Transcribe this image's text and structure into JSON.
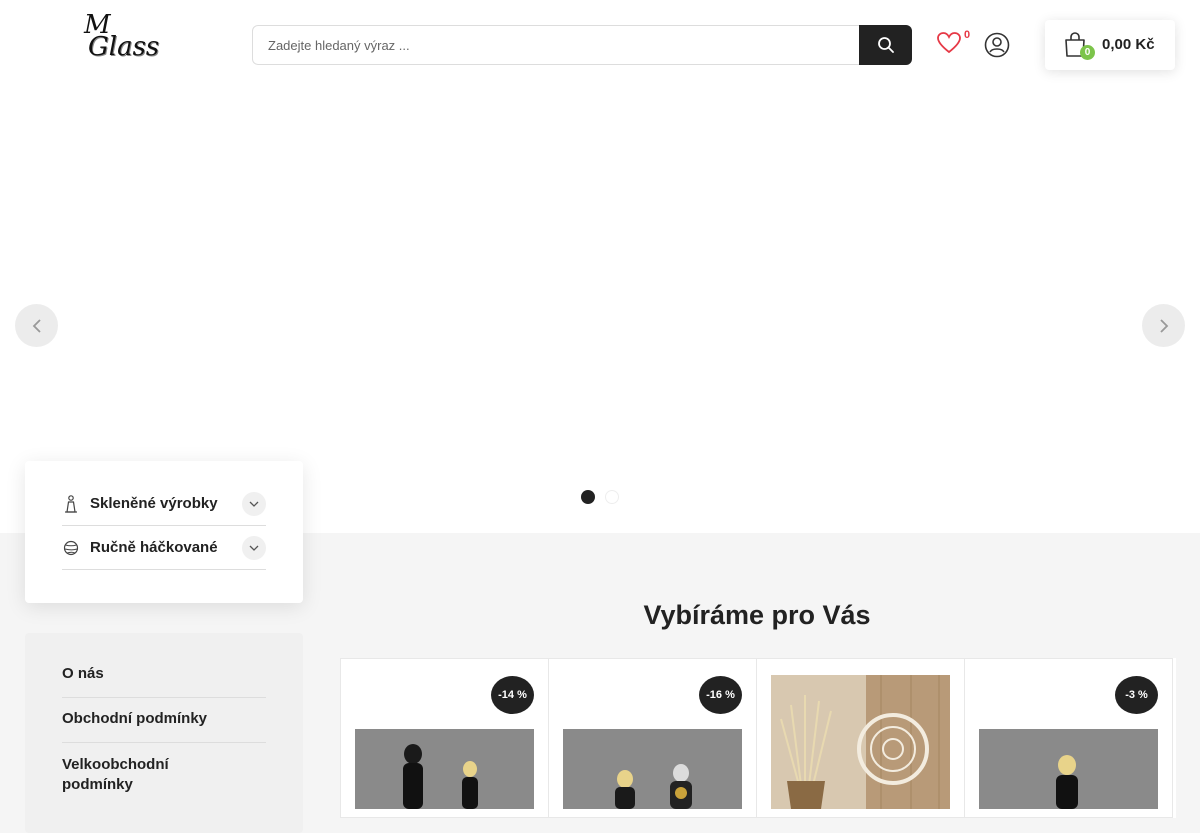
{
  "header": {
    "logo_line1": "M",
    "logo_line2": "Glass",
    "search_placeholder": "Zadejte hledaný výraz ...",
    "wishlist_count": "0",
    "cart_count": "0",
    "cart_total": "0,00 Kč",
    "icons": [
      "search-icon",
      "heart-icon",
      "user-icon",
      "shopping-bag-icon"
    ]
  },
  "slider": {
    "dots": 2,
    "active_dot": 1
  },
  "categories": [
    {
      "label": "Skleněné výrobky",
      "icon": "glass-figure-icon"
    },
    {
      "label": "Ručně háčkované",
      "icon": "yarn-ball-icon"
    }
  ],
  "info_links": [
    {
      "label": "O nás"
    },
    {
      "label": "Obchodní podmínky"
    },
    {
      "label": "Velkoobchodní podmínky"
    }
  ],
  "products": {
    "title": "Vybíráme pro Vás",
    "items": [
      {
        "badge": "-14 %"
      },
      {
        "badge": "-16 %"
      },
      {
        "badge": ""
      },
      {
        "badge": "-3 %"
      }
    ]
  },
  "colors": {
    "accent_dark": "#222222",
    "cart_badge": "#7cc44a",
    "wishlist_count": "#e63946"
  }
}
